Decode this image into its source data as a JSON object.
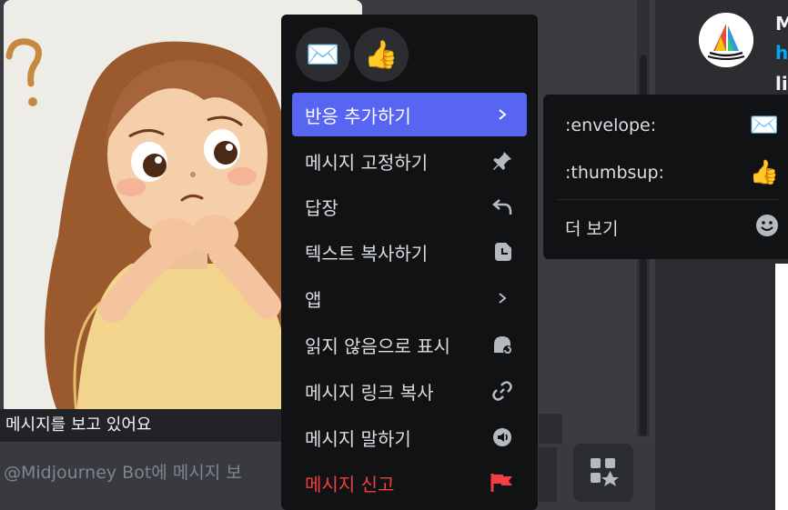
{
  "background": {
    "caption": "메시지를 보고 있어요",
    "composer_placeholder": "@Midjourney Bot에 메시지 보",
    "member_texts": [
      "M",
      "h",
      "li"
    ]
  },
  "quick_reactions": [
    {
      "emoji": "✉️",
      "icon": "envelope-icon"
    },
    {
      "emoji": "👍",
      "icon": "thumbsup-icon"
    }
  ],
  "menu": {
    "items": [
      {
        "label": "반응 추가하기",
        "icon": "chevron-right-icon",
        "state": "active"
      },
      {
        "label": "메시지 고정하기",
        "icon": "pin-icon"
      },
      {
        "label": "답장",
        "icon": "reply-icon"
      },
      {
        "label": "텍스트 복사하기",
        "icon": "copy-icon"
      },
      {
        "label": "앱",
        "icon": "chevron-right-icon"
      },
      {
        "label": "읽지 않음으로 표시",
        "icon": "mark-unread-icon"
      },
      {
        "label": "메시지 링크 복사",
        "icon": "link-icon"
      },
      {
        "label": "메시지 말하기",
        "icon": "speak-icon"
      },
      {
        "label": "메시지 신고",
        "icon": "flag-icon",
        "state": "danger"
      }
    ]
  },
  "submenu": {
    "items": [
      {
        "label": ":envelope:",
        "emoji": "✉️"
      },
      {
        "label": ":thumbsup:",
        "emoji": "👍"
      },
      {
        "label": "더 보기",
        "icon": "smiley-icon"
      }
    ]
  },
  "colors": {
    "accent": "#5865f2",
    "danger": "#f23f42",
    "menu_bg": "#111214"
  }
}
